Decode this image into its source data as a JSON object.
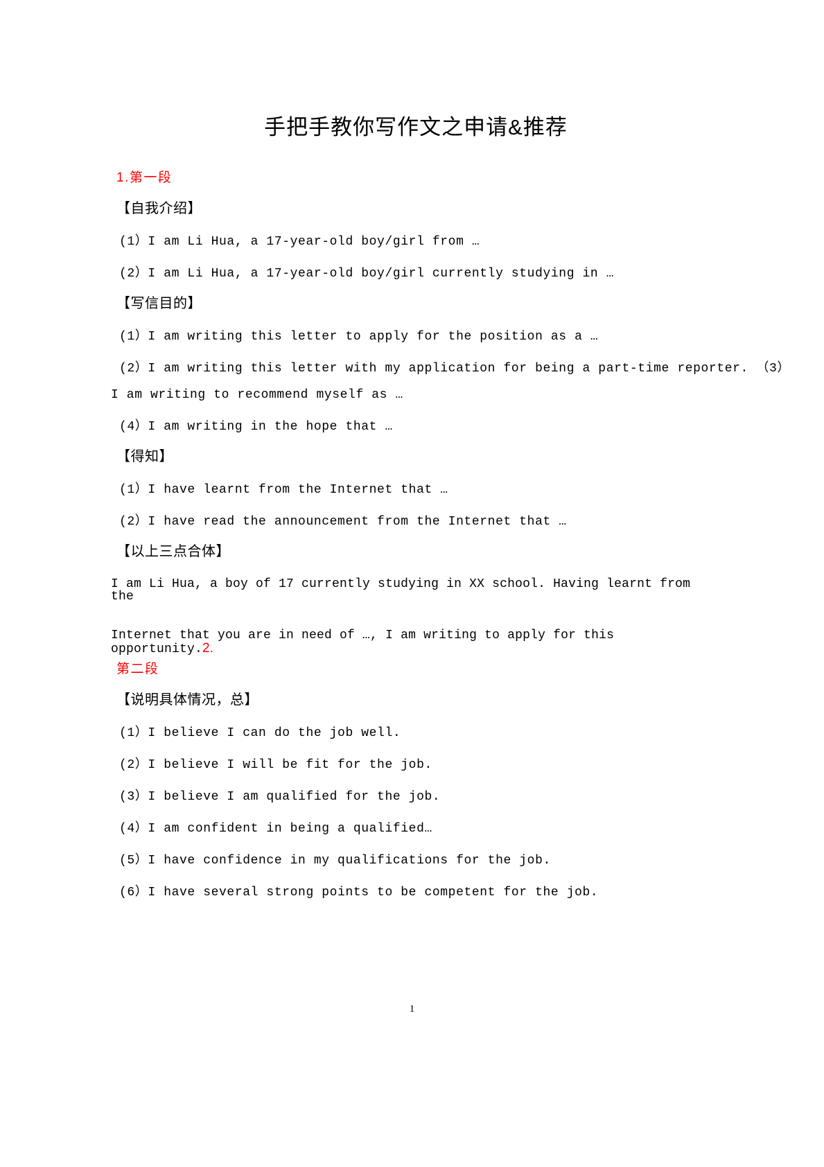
{
  "document": {
    "title": "手把手教你写作文之申请&推荐",
    "page_number": "1",
    "accent_color": "#ff0000",
    "text_color": "#000000",
    "background_color": "#ffffff"
  },
  "section1": {
    "heading": "1.第一段",
    "blocks": [
      {
        "label": "【自我介绍】",
        "items": [
          "(1）I am Li Hua, a 17-year-old boy/girl from …",
          "(2）I am Li Hua, a 17-year-old boy/girl currently studying in …"
        ]
      },
      {
        "label": "【写信目的】",
        "items": [
          "(1）I am writing this letter to apply for the position as a …",
          "(2）I am writing this letter with my application for being a part-time reporter. （3）",
          "I am writing to recommend myself as …",
          "(4）I am writing in the hope that …"
        ]
      },
      {
        "label": "【得知】",
        "items": [
          "(1）I have learnt from the Internet that …",
          "(2）I have read the announcement from the Internet that …"
        ]
      },
      {
        "label": "【以上三点合体】",
        "items": [
          "I am Li Hua, a boy of 17 currently studying in XX school. Having learnt from the",
          "Internet that you are in need of …, I am writing to apply for this opportunity."
        ]
      }
    ]
  },
  "section2": {
    "heading_number": "2.",
    "heading": "第二段",
    "blocks": [
      {
        "label": "【说明具体情况，总】",
        "items": [
          "(1）I believe I can do the job well.",
          "(2）I believe I will be fit for the job.",
          "(3）I believe I am qualified for the job.",
          "(4）I am confident in being a qualified…",
          "(5）I have confidence in my qualifications for the job.",
          "(6）I have several strong points to be competent for the job."
        ]
      }
    ]
  }
}
